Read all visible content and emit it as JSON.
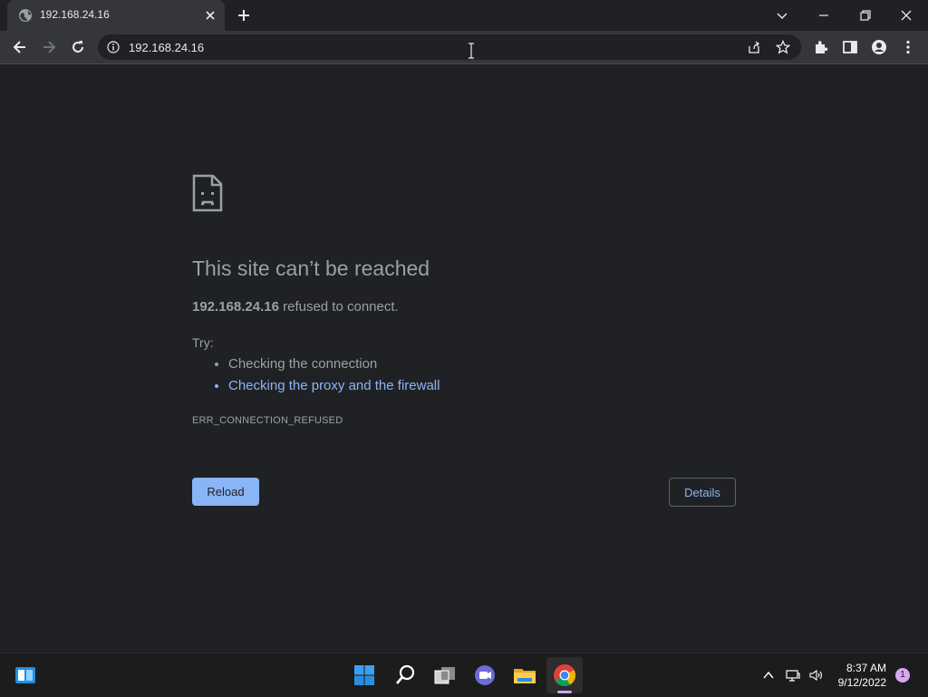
{
  "tab": {
    "title": "192.168.24.16",
    "favicon": "globe-icon",
    "close": "close-icon"
  },
  "toolbar": {
    "back": "back-arrow-icon",
    "forward": "forward-arrow-icon",
    "reload": "reload-icon",
    "url": "192.168.24.16",
    "extensions": "puzzle-icon",
    "side_panel": "side-panel-icon",
    "profile": "profile-icon",
    "menu": "kebab-menu-icon"
  },
  "window_controls": [
    "chevron-down-icon",
    "minimize-icon",
    "restore-icon",
    "close-icon"
  ],
  "error_page": {
    "title": "This site can’t be reached",
    "host": "192.168.24.16",
    "message": " refused to connect.",
    "try_label": "Try:",
    "suggestions": [
      {
        "text": "Checking the connection",
        "link": false
      },
      {
        "text": "Checking the proxy and the firewall",
        "link": true
      }
    ],
    "error_code": "ERR_CONNECTION_REFUSED",
    "reload_label": "Reload",
    "details_label": "Details"
  },
  "taskbar": {
    "pinned": [
      "widgets-icon",
      "start-icon",
      "search-icon",
      "task-view-icon",
      "teams-chat-icon",
      "file-explorer-icon",
      "chrome-icon"
    ],
    "active": "chrome-icon",
    "tray": [
      "chevron-up-icon",
      "network-icon",
      "volume-icon"
    ],
    "time": "8:37 AM",
    "date": "9/12/2022",
    "notification_count": "1"
  },
  "colors": {
    "page_bg": "#202124",
    "toolbar_bg": "#35363a",
    "accent": "#8ab4f8",
    "text_muted": "#9aa0a6"
  }
}
